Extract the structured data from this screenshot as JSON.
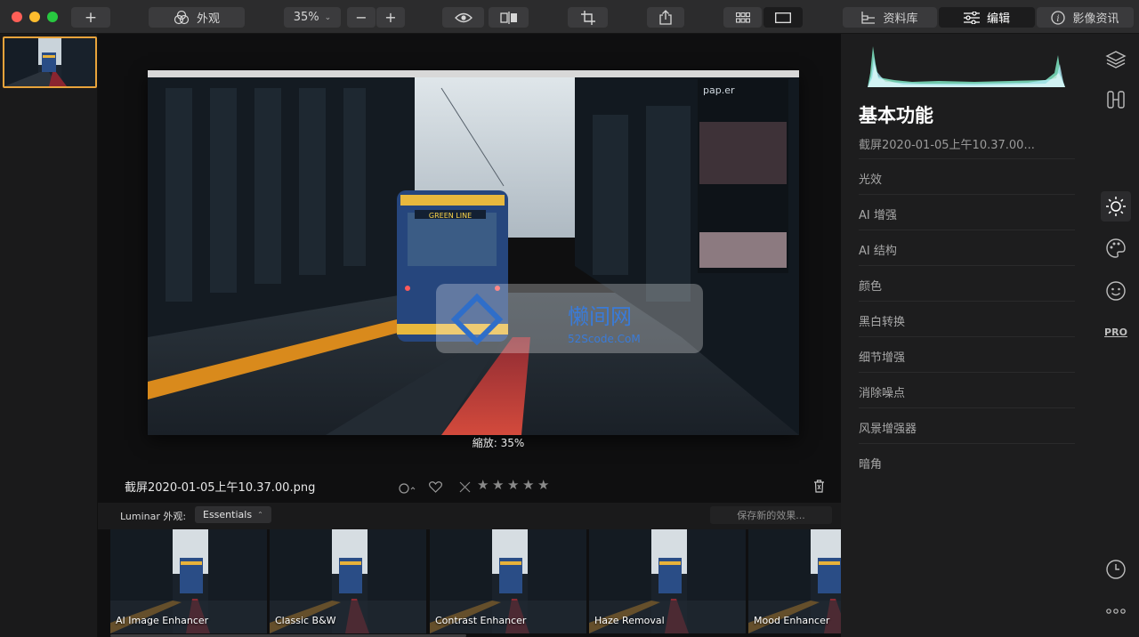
{
  "toolbar": {
    "add_label": "+",
    "looks_label": "外观",
    "zoom_value": "35%",
    "zoom_out": "−",
    "zoom_in": "+",
    "tabs": [
      {
        "label": "资料库",
        "icon": "library-icon"
      },
      {
        "label": "编辑",
        "icon": "sliders-icon"
      },
      {
        "label": "影像资讯",
        "icon": "info-icon"
      }
    ]
  },
  "canvas": {
    "zoom_label": "縮放: 35%",
    "filename": "截屏2020-01-05上午10.37.00.png",
    "rating_stars": 5
  },
  "looks": {
    "label": "Luminar 外观:",
    "selected": "Essentials",
    "save_label": "保存新的效果...",
    "presets": [
      {
        "label": "AI Image Enhancer"
      },
      {
        "label": "Classic B&W"
      },
      {
        "label": "Contrast Enhancer"
      },
      {
        "label": "Haze Removal"
      },
      {
        "label": "Mood Enhancer"
      }
    ]
  },
  "panel": {
    "title": "基本功能",
    "subtitle": "截屏2020-01-05上午10.37.00...",
    "tools": [
      "光效",
      "AI 增强",
      "AI 结构",
      "颜色",
      "黑白转换",
      "细节增强",
      "消除噪点",
      "风景增强器",
      "暗角"
    ]
  },
  "sidebar_icons": {
    "pro_label": "PRO"
  },
  "watermark": {
    "title": "懒间网",
    "url": "52Scode.CoM"
  }
}
